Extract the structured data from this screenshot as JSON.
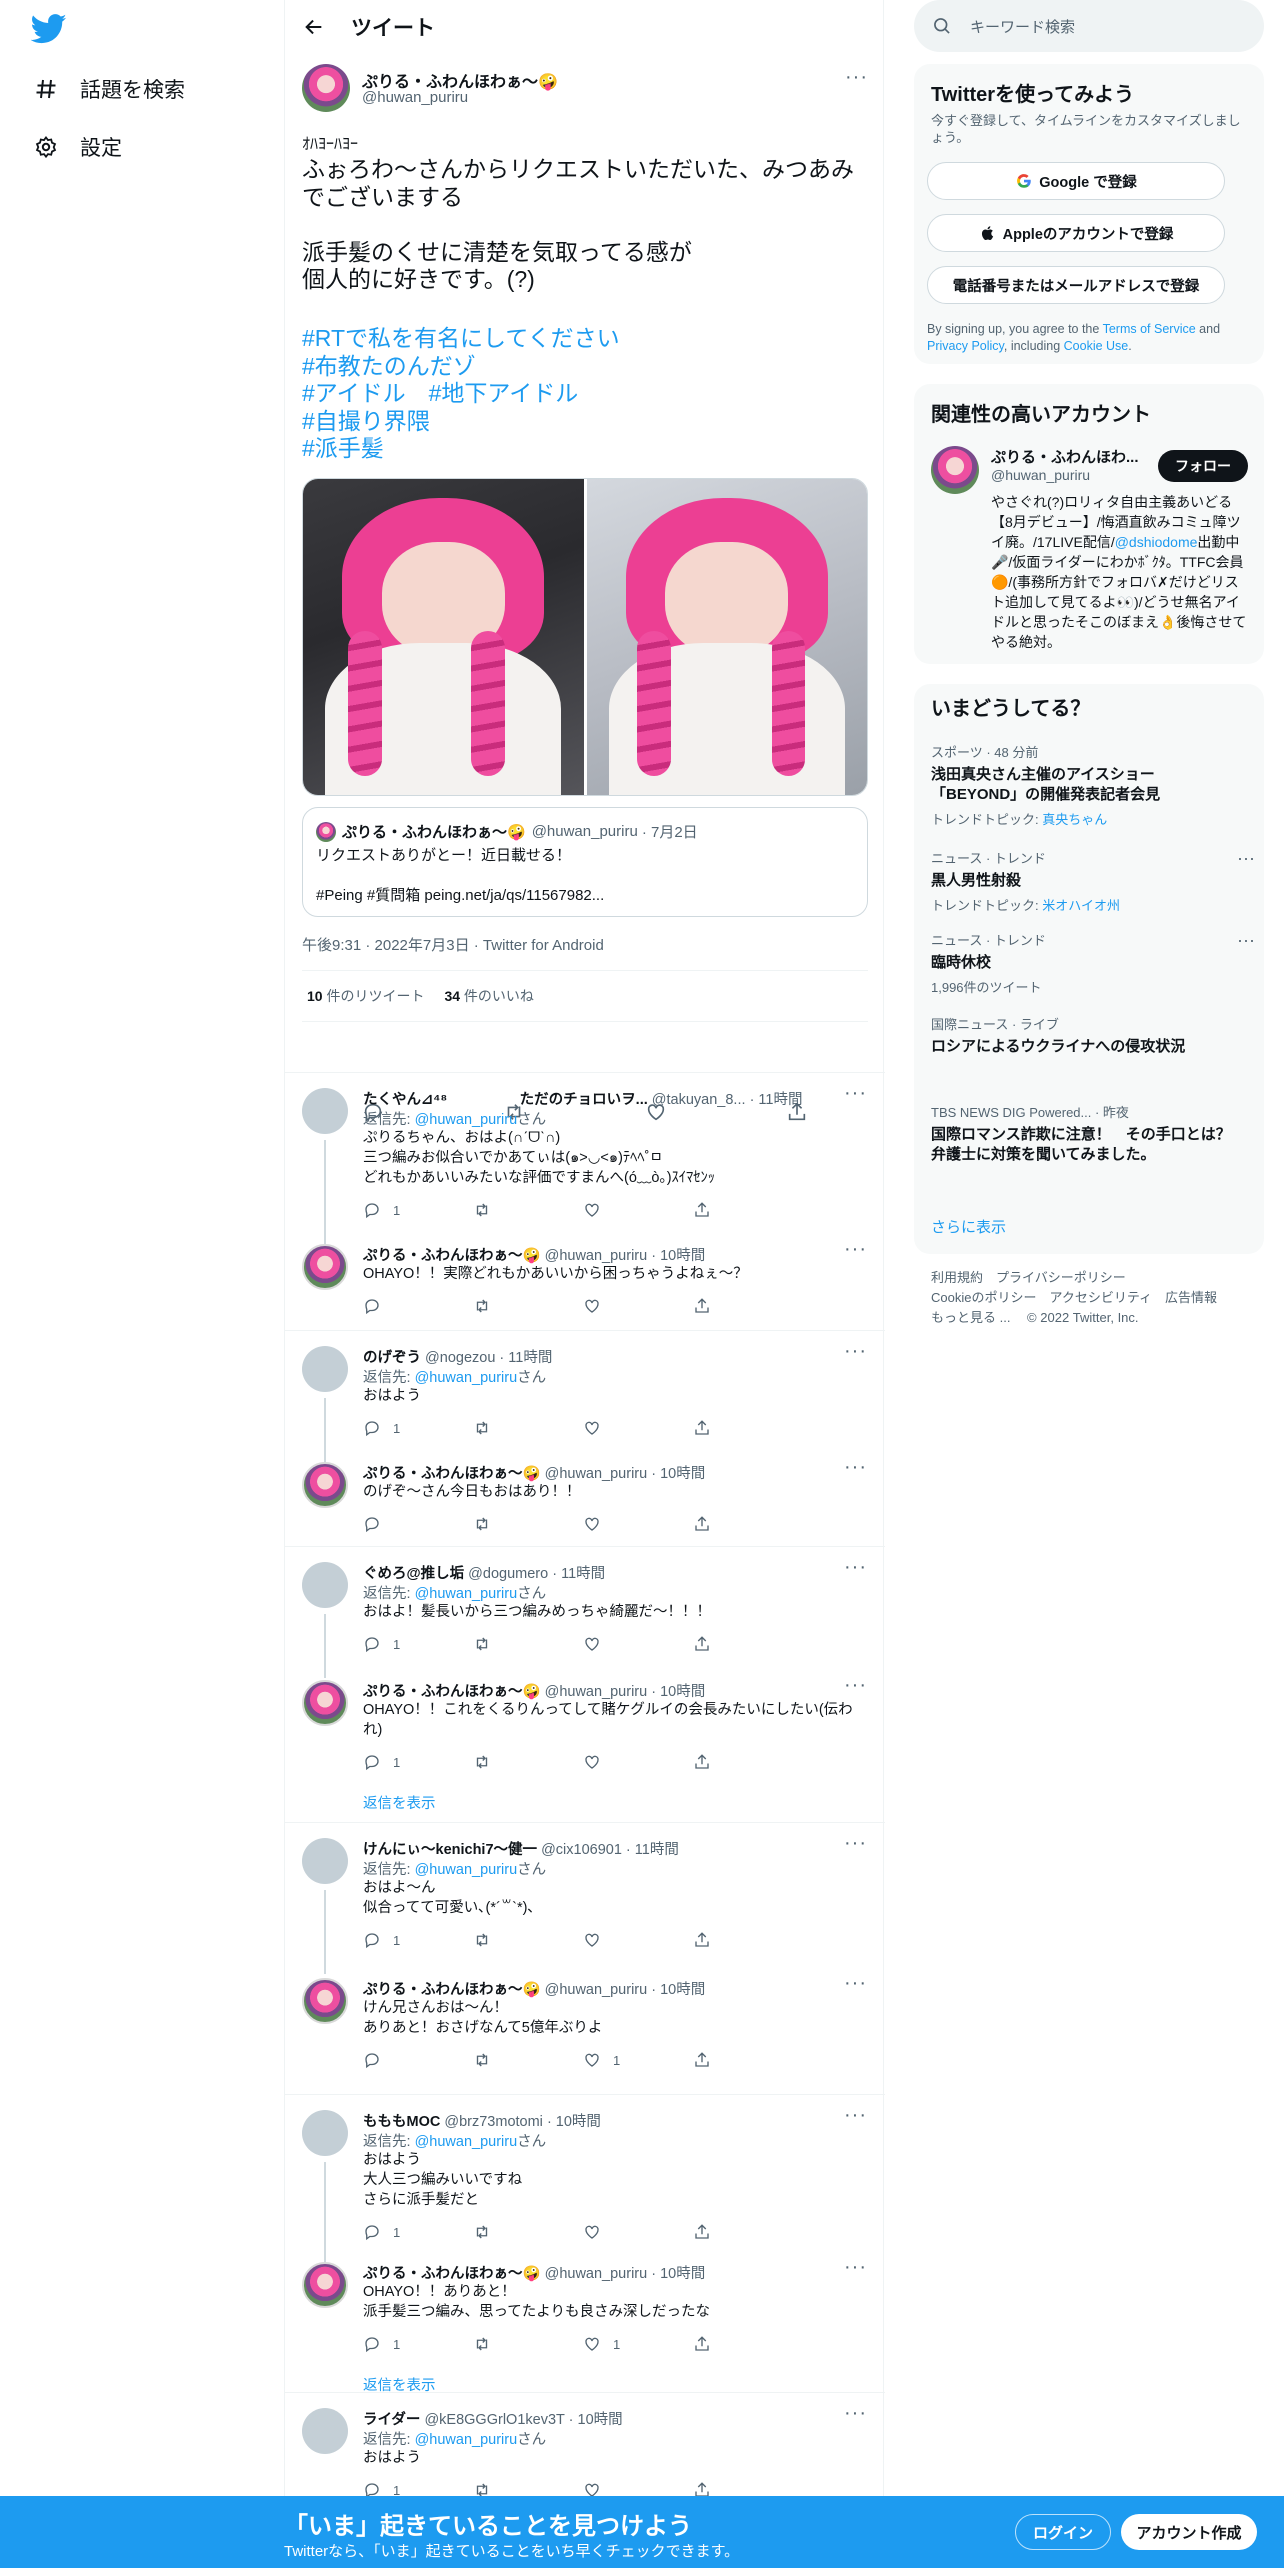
{
  "nav": {
    "explore": "話題を検索",
    "settings": "設定"
  },
  "header": {
    "title": "ツイート"
  },
  "tweet": {
    "name": "ぷりる・ふわんほわぁ〜🤪",
    "handle": "@huwan_puriru",
    "line1": "ｵﾊﾖｰﾊﾖｰ",
    "text": "ふぉろわ〜さんからリクエストいただいた、みつあみでございまする\n\n派手髪のくせに清楚を気取ってる感が\n個人的に好きです。(?)",
    "hashtags": [
      "#RTで私を有名にしてください",
      "#布教たのんだゾ",
      "#アイドル　#地下アイドル",
      "#自撮り界隈",
      "#派手髪"
    ],
    "quote": {
      "name": "ぷりる・ふわんほわぁ〜🤪",
      "handle": "@huwan_puriru",
      "date": "· 7月2日",
      "text": "リクエストありがとー！近日載せる！\n\n#Peing #質問箱 peing.net/ja/qs/11567982..."
    },
    "meta": "午後9:31 · 2022年7月3日 · Twitter for Android",
    "retweets_n": "10",
    "retweets_label": " 件のリツイート",
    "likes_n": "34",
    "likes_label": " 件のいいね"
  },
  "replies": [
    {
      "name": "たくやん⊿⁴⁸　　　　　ただのチョロいヲ...",
      "handle": "@takuyan_8...",
      "time": "· 11時間",
      "replyto_prefix": "返信先: ",
      "replyto": "@huwan_puriru",
      "replyto_suffix": "さん",
      "text": "ぷりるちゃん、おはよ(∩ˊᗜˋ∩)\n三つ編みお似合いでかあてぃは(๑>◡<๑)ﾃﾍﾍ˚ㅁ\nどれもかあいいみたいな評価ですまんへ(ó﹏ò｡)ｽｲﾏｾﾝｯ",
      "count1": "1",
      "count3": ""
    },
    {
      "name": "ぷりる・ふわんほわぁ〜🤪",
      "handle": "@huwan_puriru",
      "time": "· 10時間",
      "text": "OHAYO！！実際どれもかあいいから困っちゃうよねぇ〜？",
      "count1": "",
      "count3": ""
    },
    {
      "name": "のげぞう",
      "handle": "@nogezou",
      "time": "· 11時間",
      "replyto_prefix": "返信先: ",
      "replyto": "@huwan_puriru",
      "replyto_suffix": "さん",
      "text": "おはよう",
      "count1": "1",
      "count3": ""
    },
    {
      "name": "ぷりる・ふわんほわぁ〜🤪",
      "handle": "@huwan_puriru",
      "time": "· 10時間",
      "text": "のげぞ〜さん今日もおはあり！！",
      "count1": "",
      "count3": ""
    },
    {
      "name": "ぐめろ@推し垢",
      "handle": "@dogumero",
      "time": "· 11時間",
      "replyto_prefix": "返信先: ",
      "replyto": "@huwan_puriru",
      "replyto_suffix": "さん",
      "text": "おはよ！髪長いから三つ編みめっちゃ綺麗だ〜！！！",
      "count1": "1",
      "count3": ""
    },
    {
      "name": "ぷりる・ふわんほわぁ〜🤪",
      "handle": "@huwan_puriru",
      "time": "· 10時間",
      "text": "OHAYO！！これをくるりんってして賭ケグルイの会長みたいにしたい(伝われ)",
      "count1": "1",
      "count3": ""
    },
    {
      "name": "けんにぃ〜kenichi7〜健一",
      "handle": "@cix106901",
      "time": "· 11時間",
      "replyto_prefix": "返信先: ",
      "replyto": "@huwan_puriru",
      "replyto_suffix": "さん",
      "text": "おはよ〜ん\n似合ってて可愛い､(*´꒳`*)､",
      "count1": "1",
      "count3": ""
    },
    {
      "name": "ぷりる・ふわんほわぁ〜🤪",
      "handle": "@huwan_puriru",
      "time": "· 10時間",
      "text": "けん兄さんおは〜ん！\nありあと！おさげなんて5億年ぶりよ",
      "count1": "",
      "count3": "1"
    },
    {
      "name": "もももMOC",
      "handle": "@brz73motomi",
      "time": "· 10時間",
      "replyto_prefix": "返信先: ",
      "replyto": "@huwan_puriru",
      "replyto_suffix": "さん",
      "text": "おはよう\n大人三つ編みいいですね\nさらに派手髪だと",
      "count1": "1",
      "count3": ""
    },
    {
      "name": "ぷりる・ふわんほわぁ〜🤪",
      "handle": "@huwan_puriru",
      "time": "· 10時間",
      "text": "OHAYO！！ありあと！\n派手髪三つ編み、思ってたよりも良さみ深しだったな",
      "count1": "1",
      "count3": "1"
    },
    {
      "name": "ライダー",
      "handle": "@kE8GGGrlO1kev3T",
      "time": "· 10時間",
      "replyto_prefix": "返信先: ",
      "replyto": "@huwan_puriru",
      "replyto_suffix": "さん",
      "text": "おはよう",
      "count1": "1",
      "count3": ""
    }
  ],
  "show_replies": "返信を表示",
  "search": {
    "placeholder": "キーワード検索"
  },
  "signup": {
    "title": "Twitterを使ってみよう",
    "desc": "今すぐ登録して、タイムラインをカスタマイズしましょう。",
    "google": "Google で登録",
    "apple": "Appleのアカウントで登録",
    "phone": "電話番号またはメールアドレスで登録",
    "terms_pre": "By signing up, you agree to the ",
    "terms": "Terms of Service",
    "terms_and": " and ",
    "privacy": "Privacy Policy",
    "terms_inc": ", including ",
    "cookie": "Cookie Use",
    "terms_end": "."
  },
  "related": {
    "title": "関連性の高いアカウント",
    "name": "ぷりる・ふわんほわ...",
    "handle": "@huwan_puriru",
    "follow": "フォロー",
    "bio": "やさぐれ(?)ロリィタ自由主義あいどる【8月デビュー】/悔酒直飲みコミュ障ツイ廃。/17LIVE配信/",
    "bio_link": "@dshiodome",
    "bio2": "出勤中🎤/仮面ライダーにわかﾎﾞｸﾀ。TTFC会員🟠/(事務所方針でフォロバ✗だけどリスト追加して見てるよ👀)/どうせ無名アイドルと思ったそこのぼまえ👌後悔させてやる絶対。"
  },
  "trends": {
    "title": "いまどうしてる？",
    "items": [
      {
        "cat": "スポーツ · 48 分前",
        "title": "浅田真央さん主催のアイスショー「BEYOND」の開催発表記者会見",
        "sub_pre": "トレンドトピック: ",
        "sub_link": "真央ちゃん"
      },
      {
        "cat": "ニュース · トレンド",
        "title": "黒人男性射殺",
        "sub_pre": "トレンドトピック: ",
        "sub_link": "米オハイオ州"
      },
      {
        "cat": "ニュース · トレンド",
        "title": "臨時休校",
        "sub_pre": "1,996件のツイート",
        "sub_link": ""
      },
      {
        "cat": "国際ニュース · ライブ",
        "title": "ロシアによるウクライナへの侵攻状況",
        "sub_pre": "",
        "sub_link": ""
      },
      {
        "cat": "TBS NEWS DIG Powered... · 昨夜",
        "title": "国際ロマンス詐欺に注意！　その手口とは？　弁護士に対策を聞いてみました。",
        "sub_pre": "",
        "sub_link": ""
      }
    ],
    "more": "さらに表示"
  },
  "footer": {
    "line1": "利用規約　プライバシーポリシー",
    "line2": "Cookieのポリシー　アクセシビリティ　広告情報",
    "line3": "もっと見る ...　 © 2022 Twitter, Inc."
  },
  "bottom": {
    "headline": "「いま」起きていることを見つけよう",
    "sub": "Twitterなら、「いま」起きていることをいち早くチェックできます。",
    "login": "ログイン",
    "signup": "アカウント作成"
  },
  "colors": {
    "accent": "#1d9bf0",
    "text": "#0f1419",
    "muted": "#536471"
  }
}
